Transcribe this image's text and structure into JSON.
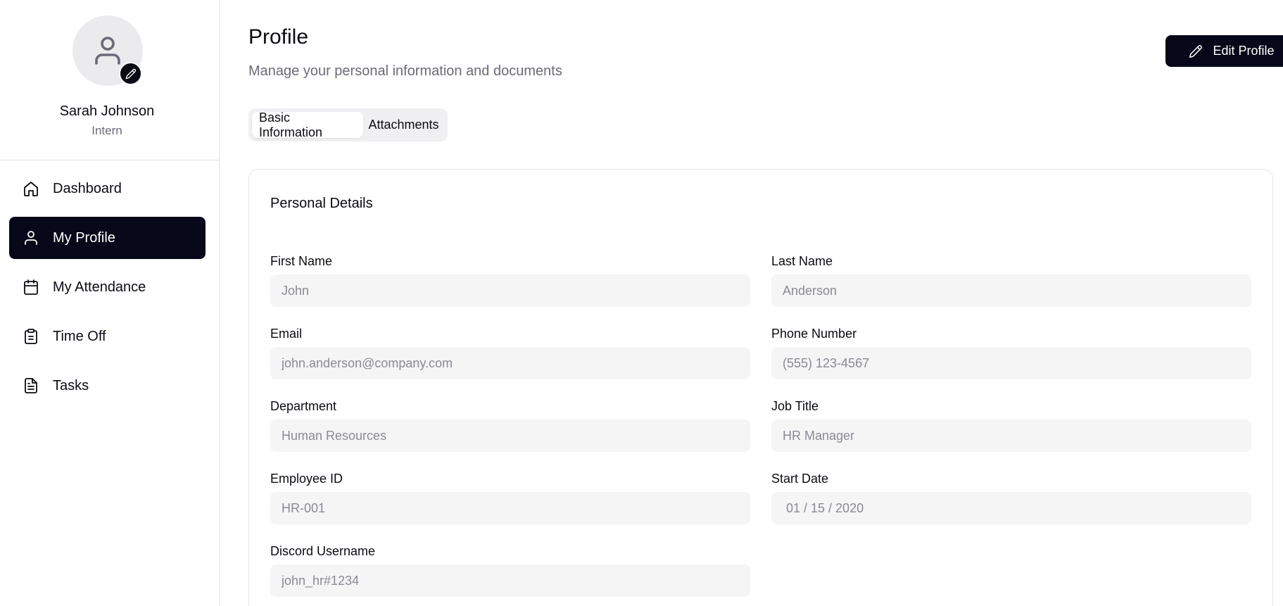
{
  "sidebar": {
    "user": {
      "name": "Sarah Johnson",
      "role": "Intern"
    },
    "items": [
      {
        "label": "Dashboard",
        "icon": "home-icon",
        "active": false
      },
      {
        "label": "My Profile",
        "icon": "user-icon",
        "active": true
      },
      {
        "label": "My Attendance",
        "icon": "calendar-icon",
        "active": false
      },
      {
        "label": "Time Off",
        "icon": "clipboard-icon",
        "active": false
      },
      {
        "label": "Tasks",
        "icon": "file-text-icon",
        "active": false
      }
    ]
  },
  "header": {
    "title": "Profile",
    "subtitle": "Manage your personal information and documents",
    "edit_label": "Edit Profile"
  },
  "tabs": [
    {
      "label": "Basic Information",
      "active": true
    },
    {
      "label": "Attachments",
      "active": false
    }
  ],
  "card": {
    "title": "Personal Details",
    "fields": {
      "first_name": {
        "label": "First Name",
        "value": "John"
      },
      "last_name": {
        "label": "Last Name",
        "value": "Anderson"
      },
      "email": {
        "label": "Email",
        "value": "john.anderson@company.com"
      },
      "phone": {
        "label": "Phone Number",
        "value": "(555) 123-4567"
      },
      "department": {
        "label": "Department",
        "value": "Human Resources"
      },
      "job_title": {
        "label": "Job Title",
        "value": "HR Manager"
      },
      "employee_id": {
        "label": "Employee ID",
        "value": "HR-001"
      },
      "start_date": {
        "label": "Start Date",
        "value": " 01 / 15 / 2020"
      },
      "discord": {
        "label": "Discord Username",
        "value": "john_hr#1234"
      }
    }
  },
  "colors": {
    "accent": "#07071a",
    "muted_text": "#6b6b78",
    "input_bg": "#f5f5f6",
    "border": "#e6e6ea"
  }
}
